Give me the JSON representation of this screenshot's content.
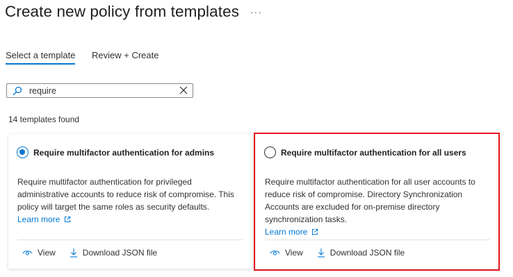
{
  "page": {
    "title": "Create new policy from templates",
    "more_label": "···"
  },
  "tabs": [
    {
      "label": "Select a template",
      "selected": true
    },
    {
      "label": "Review + Create",
      "selected": false
    }
  ],
  "search": {
    "value": "require",
    "icon": "search-icon",
    "clear_icon": "close-icon"
  },
  "results": {
    "count_text": "14 templates found"
  },
  "templates": [
    {
      "title": "Require multifactor authentication for admins",
      "selected": true,
      "description": "Require multifactor authentication for privileged administrative accounts to reduce risk of compromise. This policy will target the same roles as security defaults.",
      "learn_more": "Learn more",
      "view_label": "View",
      "download_label": "Download JSON file"
    },
    {
      "title": "Require multifactor authentication for all users",
      "selected": false,
      "highlighted": true,
      "description": "Require multifactor authentication for all user accounts to reduce risk of compromise. Directory Synchronization Accounts are excluded for on-premise directory synchronization tasks.",
      "learn_more": "Learn more",
      "view_label": "View",
      "download_label": "Download JSON file"
    }
  ],
  "colors": {
    "accent": "#0078d4",
    "highlight_border": "#e3161c",
    "text": "#323130"
  }
}
